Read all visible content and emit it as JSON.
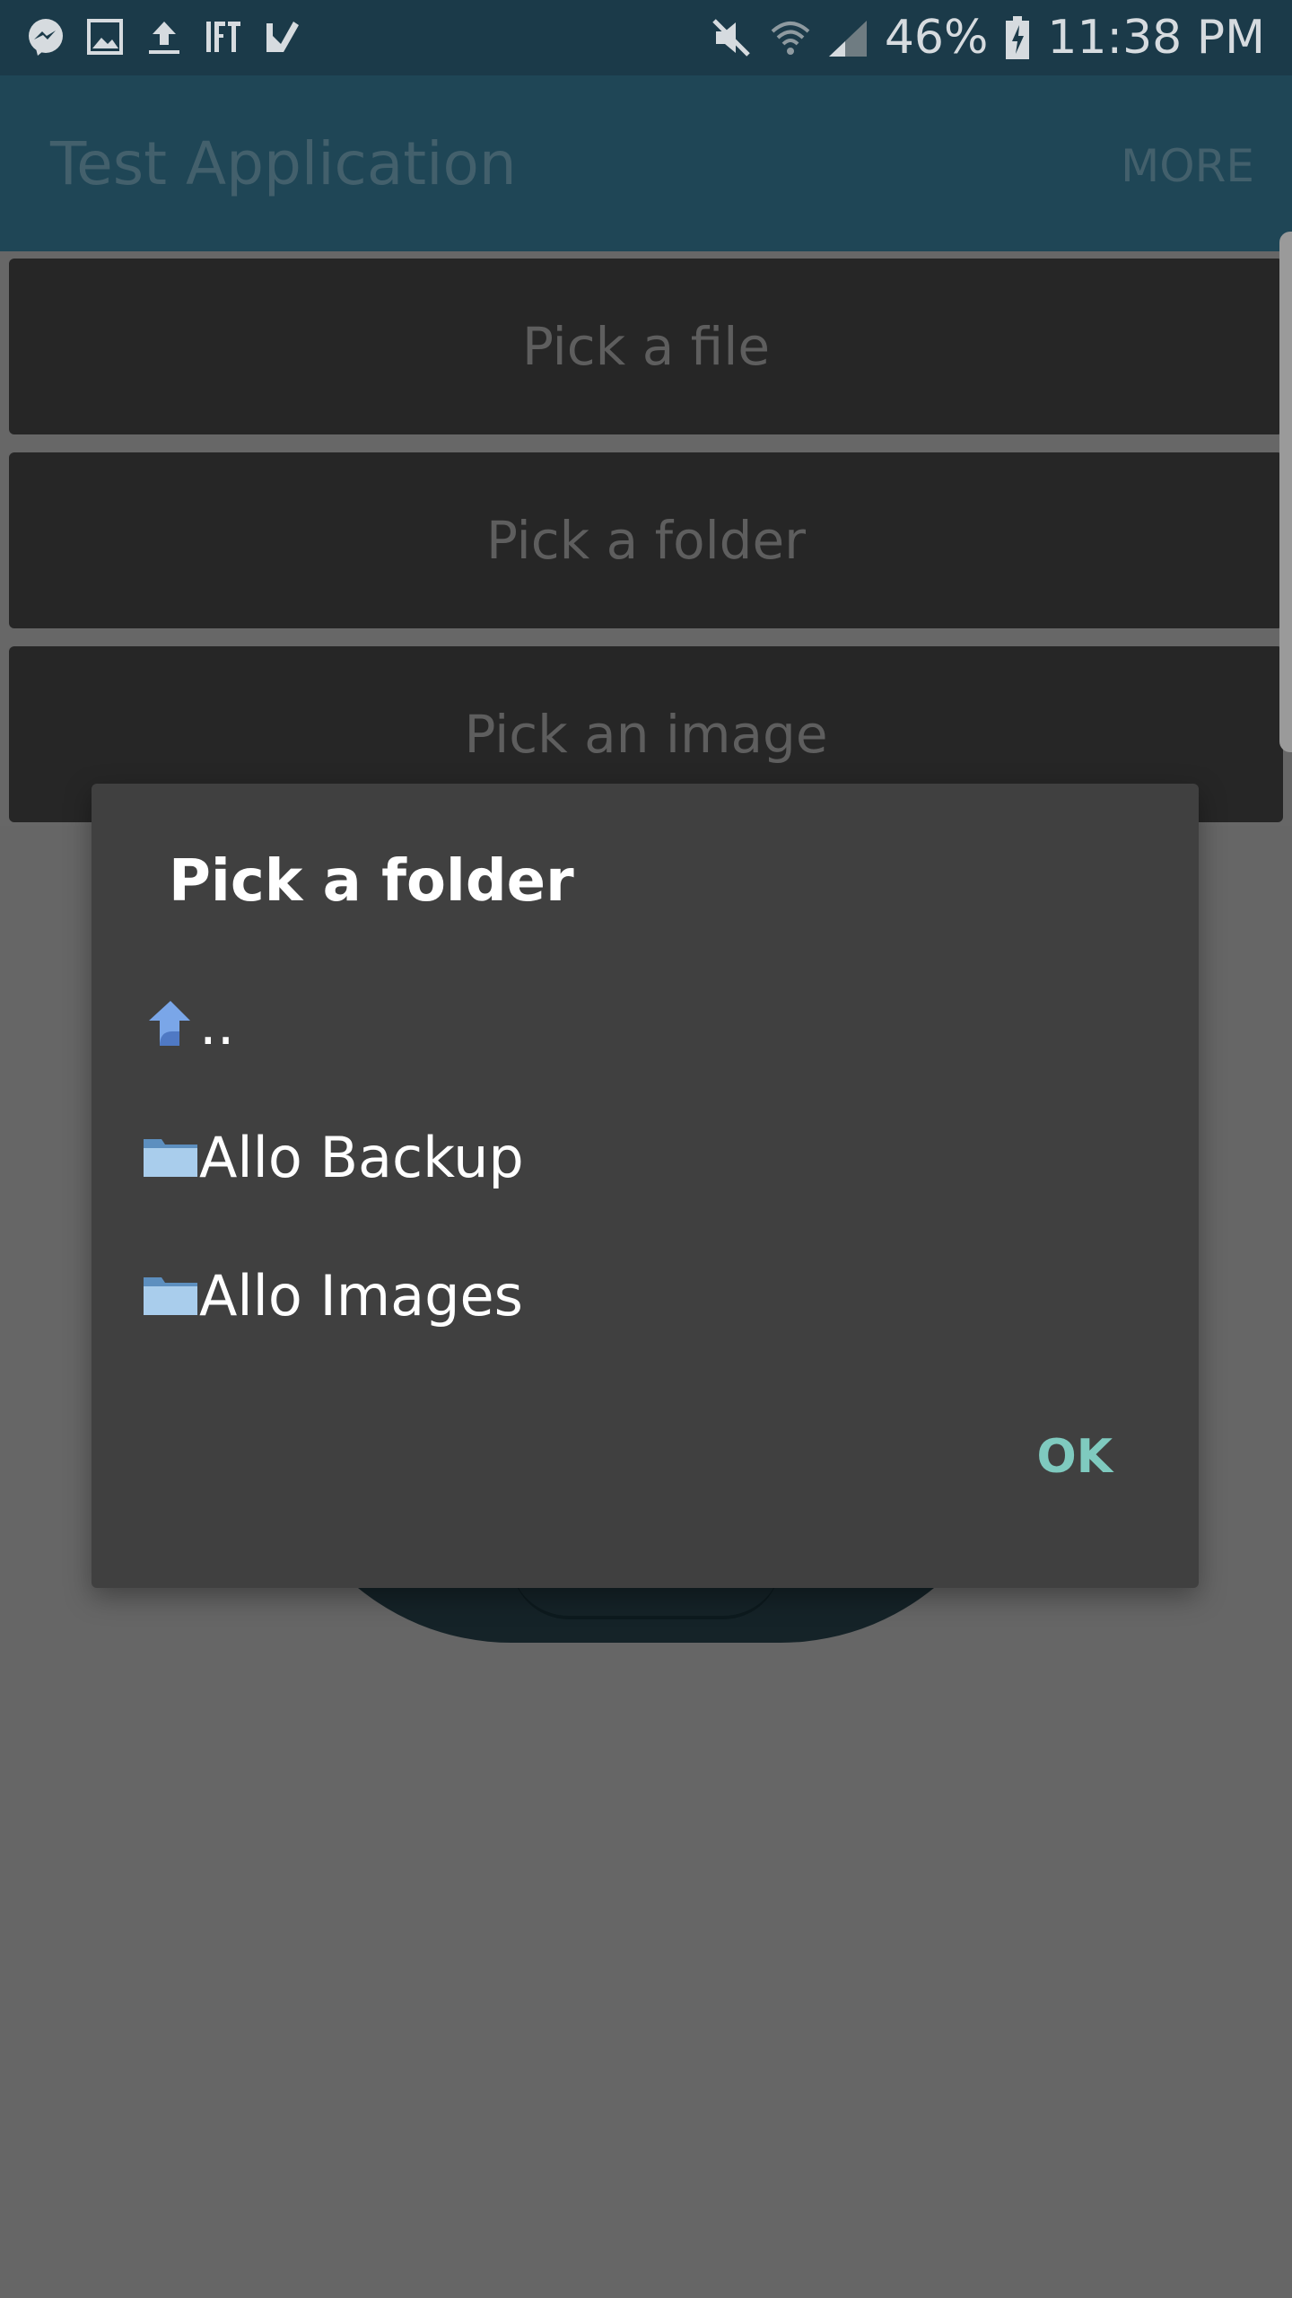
{
  "status_bar": {
    "left_icons": [
      "messenger-icon",
      "image-icon",
      "upload-icon",
      "ifttt-icon",
      "task-check-icon"
    ],
    "right_icons": [
      "mute-icon",
      "wifi-icon",
      "signal-icon",
      "battery-charging-icon"
    ],
    "battery": "46%",
    "time": "11:38 PM"
  },
  "app_bar": {
    "title": "Test Application",
    "more_label": "MORE"
  },
  "buttons": {
    "pick_file": "Pick a file",
    "pick_folder": "Pick a folder",
    "pick_image": "Pick an image"
  },
  "dialog": {
    "title": "Pick a folder",
    "items": [
      {
        "label": "..",
        "icon": "folder-up-icon"
      },
      {
        "label": "Allo Backup",
        "icon": "folder-icon"
      },
      {
        "label": "Allo Images",
        "icon": "folder-icon"
      }
    ],
    "ok_label": "OK"
  },
  "colors": {
    "status_bar": "#1b3a49",
    "app_bar": "#1f4656",
    "dialog_bg": "#404040",
    "accent_ok": "#7fcabf"
  }
}
